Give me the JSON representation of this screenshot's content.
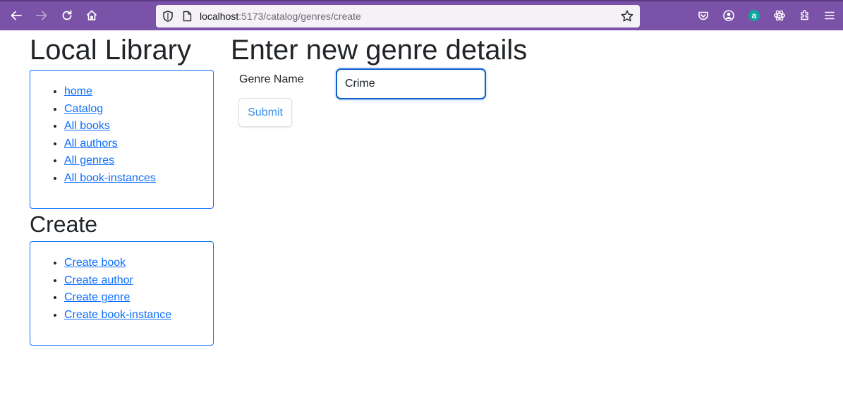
{
  "browser": {
    "url_host": "localhost",
    "url_path": ":5173/catalog/genres/create",
    "toolbar_icons": [
      "back-icon",
      "forward-icon",
      "reload-icon",
      "home-icon",
      "shield-icon",
      "page-icon",
      "bookmark-star-icon",
      "pocket-icon",
      "account-icon",
      "amazon-extension-icon",
      "react-devtools-icon",
      "extensions-icon",
      "menu-icon"
    ],
    "accent_color": "#7a52a7"
  },
  "sidebar": {
    "title": "Local Library",
    "nav_items": [
      {
        "label": "home"
      },
      {
        "label": "Catalog"
      },
      {
        "label": "All books"
      },
      {
        "label": "All authors"
      },
      {
        "label": "All genres"
      },
      {
        "label": "All book-instances"
      }
    ],
    "create_title": "Create",
    "create_items": [
      {
        "label": "Create book"
      },
      {
        "label": "Create author"
      },
      {
        "label": "Create genre"
      },
      {
        "label": "Create book-instance"
      }
    ]
  },
  "main": {
    "title": "Enter new genre details",
    "form": {
      "genre_label": "Genre Name",
      "genre_value": "Crime",
      "submit_label": "Submit"
    }
  },
  "colors": {
    "link": "#0d6efd",
    "box_border": "#0d6efd"
  }
}
